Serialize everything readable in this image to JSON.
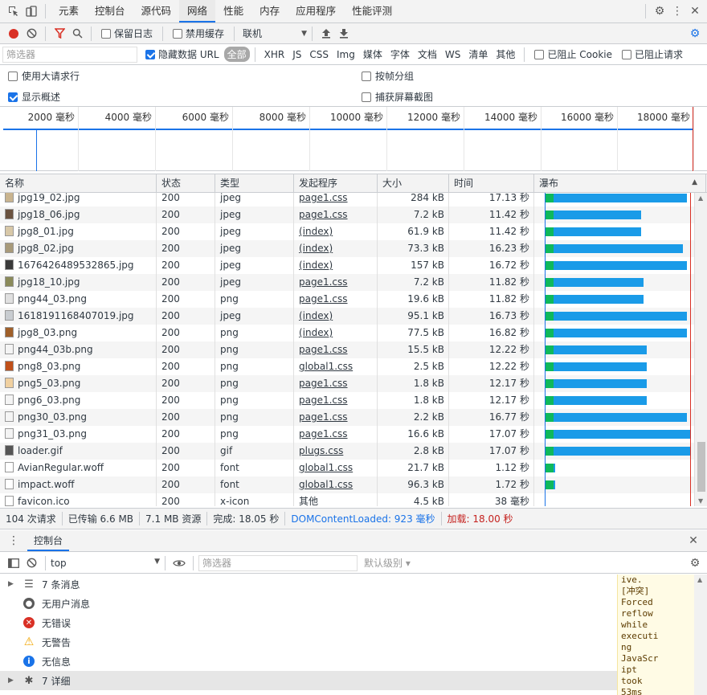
{
  "tabs": [
    "元素",
    "控制台",
    "源代码",
    "网络",
    "性能",
    "内存",
    "应用程序",
    "性能评测"
  ],
  "active_tab": "网络",
  "toolbar": {
    "preserve_log": "保留日志",
    "disable_cache": "禁用缓存",
    "throttle": "联机"
  },
  "filter": {
    "placeholder": "筛选器",
    "hide_data_url": "隐藏数据 URL",
    "types": [
      "全部",
      "XHR",
      "JS",
      "CSS",
      "Img",
      "媒体",
      "字体",
      "文档",
      "WS",
      "清单",
      "其他"
    ],
    "blocked_cookies": "已阻止 Cookie",
    "blocked_requests": "已阻止请求"
  },
  "options": {
    "large_rows": "使用大请求行",
    "group_by_frame": "按帧分组",
    "show_overview": "显示概述",
    "capture_screenshots": "捕获屏幕截图"
  },
  "overview_ticks": [
    "2000 毫秒",
    "4000 毫秒",
    "6000 毫秒",
    "8000 毫秒",
    "10000 毫秒",
    "12000 毫秒",
    "14000 毫秒",
    "16000 毫秒",
    "18000 毫秒"
  ],
  "columns": [
    "名称",
    "状态",
    "类型",
    "发起程序",
    "大小",
    "时间",
    "瀑布"
  ],
  "rows": [
    {
      "name": "jpg19_02.jpg",
      "status": "200",
      "type": "jpeg",
      "initiator": "page1.css",
      "link": true,
      "size": "284 kB",
      "time": "17.13 秒",
      "wf": 0.98,
      "icon": "#c9b48f"
    },
    {
      "name": "jpg18_06.jpg",
      "status": "200",
      "type": "jpeg",
      "initiator": "page1.css",
      "link": true,
      "size": "7.2 kB",
      "time": "11.42 秒",
      "wf": 0.66,
      "icon": "#6b5340"
    },
    {
      "name": "jpg8_01.jpg",
      "status": "200",
      "type": "jpeg",
      "initiator": "(index)",
      "link": true,
      "size": "61.9 kB",
      "time": "11.42 秒",
      "wf": 0.66,
      "icon": "#d8c8a8"
    },
    {
      "name": "jpg8_02.jpg",
      "status": "200",
      "type": "jpeg",
      "initiator": "(index)",
      "link": true,
      "size": "73.3 kB",
      "time": "16.23 秒",
      "wf": 0.95,
      "icon": "#a89a7a"
    },
    {
      "name": "1676426489532865.jpg",
      "status": "200",
      "type": "jpeg",
      "initiator": "(index)",
      "link": true,
      "size": "157 kB",
      "time": "16.72 秒",
      "wf": 0.98,
      "icon": "#3a3a3a"
    },
    {
      "name": "jpg18_10.jpg",
      "status": "200",
      "type": "jpeg",
      "initiator": "page1.css",
      "link": true,
      "size": "7.2 kB",
      "time": "11.82 秒",
      "wf": 0.68,
      "icon": "#8a8a5a"
    },
    {
      "name": "png44_03.png",
      "status": "200",
      "type": "png",
      "initiator": "page1.css",
      "link": true,
      "size": "19.6 kB",
      "time": "11.82 秒",
      "wf": 0.68,
      "icon": "#e0e0e0"
    },
    {
      "name": "1618191168407019.jpg",
      "status": "200",
      "type": "jpeg",
      "initiator": "(index)",
      "link": true,
      "size": "95.1 kB",
      "time": "16.73 秒",
      "wf": 0.98,
      "icon": "#c8ccd0"
    },
    {
      "name": "jpg8_03.png",
      "status": "200",
      "type": "png",
      "initiator": "(index)",
      "link": true,
      "size": "77.5 kB",
      "time": "16.82 秒",
      "wf": 0.98,
      "icon": "#a0602a"
    },
    {
      "name": "png44_03b.png",
      "status": "200",
      "type": "png",
      "initiator": "page1.css",
      "link": true,
      "size": "15.5 kB",
      "time": "12.22 秒",
      "wf": 0.7,
      "icon": "#f4f4f4"
    },
    {
      "name": "png8_03.png",
      "status": "200",
      "type": "png",
      "initiator": "global1.css",
      "link": true,
      "size": "2.5 kB",
      "time": "12.22 秒",
      "wf": 0.7,
      "icon": "#c0501a"
    },
    {
      "name": "png5_03.png",
      "status": "200",
      "type": "png",
      "initiator": "page1.css",
      "link": true,
      "size": "1.8 kB",
      "time": "12.17 秒",
      "wf": 0.7,
      "icon": "#f0d0a0"
    },
    {
      "name": "png6_03.png",
      "status": "200",
      "type": "png",
      "initiator": "page1.css",
      "link": true,
      "size": "1.8 kB",
      "time": "12.17 秒",
      "wf": 0.7,
      "icon": "#f4f4f4"
    },
    {
      "name": "png30_03.png",
      "status": "200",
      "type": "png",
      "initiator": "page1.css",
      "link": true,
      "size": "2.2 kB",
      "time": "16.77 秒",
      "wf": 0.98,
      "icon": "#f4f4f4"
    },
    {
      "name": "png31_03.png",
      "status": "200",
      "type": "png",
      "initiator": "page1.css",
      "link": true,
      "size": "16.6 kB",
      "time": "17.07 秒",
      "wf": 1.0,
      "icon": "#f4f4f4"
    },
    {
      "name": "loader.gif",
      "status": "200",
      "type": "gif",
      "initiator": "plugs.css",
      "link": true,
      "size": "2.8 kB",
      "time": "17.07 秒",
      "wf": 1.0,
      "icon": "#555555"
    },
    {
      "name": "AvianRegular.woff",
      "status": "200",
      "type": "font",
      "initiator": "global1.css",
      "link": true,
      "size": "21.7 kB",
      "time": "1.12 秒",
      "wf": 0.02,
      "icon": "#ffffff"
    },
    {
      "name": "impact.woff",
      "status": "200",
      "type": "font",
      "initiator": "global1.css",
      "link": true,
      "size": "96.3 kB",
      "time": "1.72 秒",
      "wf": 0.06,
      "icon": "#ffffff"
    },
    {
      "name": "favicon.ico",
      "status": "200",
      "type": "x-icon",
      "initiator": "其他",
      "link": false,
      "size": "4.5 kB",
      "time": "38 毫秒",
      "wf": 0.0,
      "icon": "#ffffff"
    }
  ],
  "summary": {
    "requests": "104 次请求",
    "transferred": "已传输 6.6 MB",
    "resources": "7.1 MB 资源",
    "finish": "完成: 18.05 秒",
    "dcl": "DOMContentLoaded: 923 毫秒",
    "load": "加载: 18.00 秒"
  },
  "drawer": {
    "tab": "控制台",
    "context": "top",
    "filter_placeholder": "筛选器",
    "levels": "默认级别 ▾"
  },
  "console_sidebar": [
    {
      "label": "7 条消息",
      "icon": "list",
      "arrow": true
    },
    {
      "label": "无用户消息",
      "icon": "user",
      "arrow": false
    },
    {
      "label": "无错误",
      "icon": "error",
      "arrow": false
    },
    {
      "label": "无警告",
      "icon": "warning",
      "arrow": false
    },
    {
      "label": "无信息",
      "icon": "info",
      "arrow": false
    },
    {
      "label": "7 详细",
      "icon": "bug",
      "arrow": true
    }
  ],
  "console_message": "ive.\n[冲突]\nForced\nreflow\nwhile\nexecuti\nng\nJavaScr\nipt\ntook\n53ms"
}
